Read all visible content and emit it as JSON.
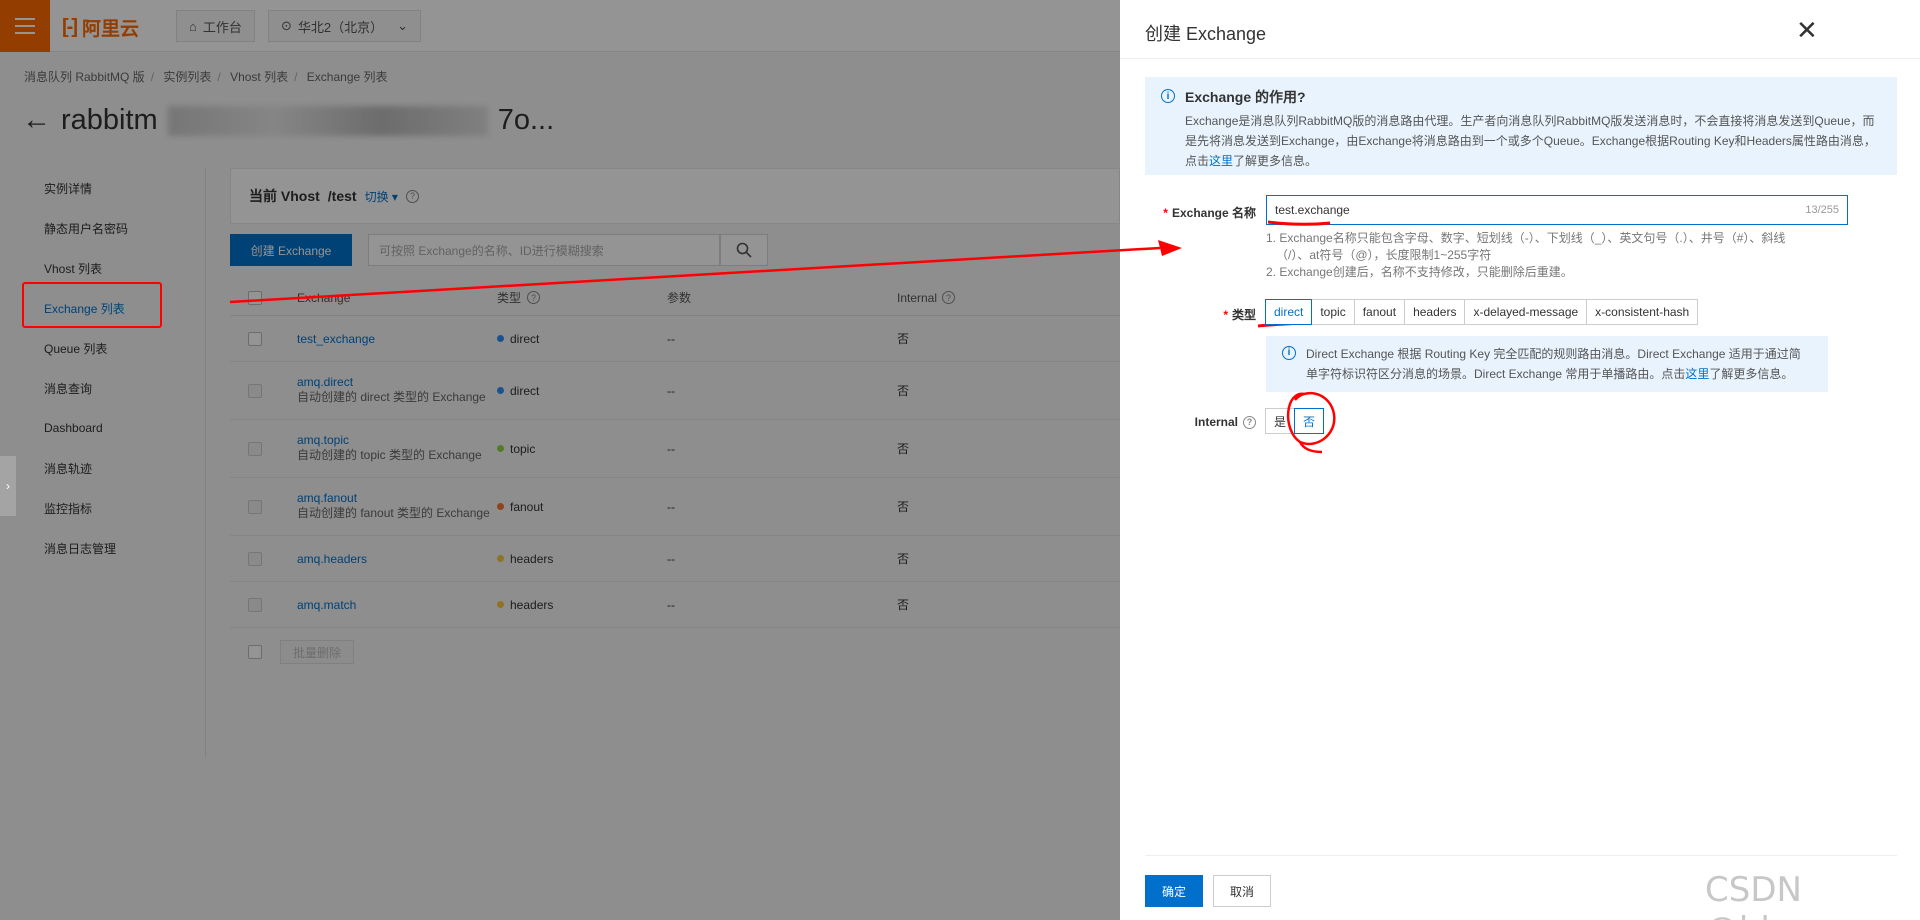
{
  "topbar": {
    "logo_text": "阿里云",
    "logo_mark": "[-]",
    "workbench_label": "工作台",
    "region_label": "华北2（北京）"
  },
  "breadcrumb": [
    "消息队列 RabbitMQ 版",
    "实例列表",
    "Vhost 列表",
    "Exchange 列表"
  ],
  "page_title": "rabbitmq-serverless-cn-20c3y7o...",
  "page_title_visible": "rabbitm",
  "page_title_tail": "7o...",
  "nav": {
    "items": [
      {
        "label": "实例详情"
      },
      {
        "label": "静态用户名密码"
      },
      {
        "label": "Vhost 列表"
      },
      {
        "label": "Exchange 列表"
      },
      {
        "label": "Queue 列表"
      },
      {
        "label": "消息查询"
      },
      {
        "label": "Dashboard"
      },
      {
        "label": "消息轨迹"
      },
      {
        "label": "监控指标"
      },
      {
        "label": "消息日志管理"
      }
    ]
  },
  "vhost": {
    "label": "当前 Vhost",
    "value": "/test",
    "switch_label": "切换"
  },
  "toolbar": {
    "create_label": "创建 Exchange",
    "search_placeholder": "可按照 Exchange的名称、ID进行模糊搜索"
  },
  "table": {
    "headers": {
      "name": "Exchange",
      "type": "类型",
      "args": "参数",
      "internal": "Internal"
    },
    "rows": [
      {
        "name": "test_exchange",
        "sub": "",
        "type": "direct",
        "type_color": "#2f8ef4",
        "args": "--",
        "internal": "否"
      },
      {
        "name": "amq.direct",
        "sub": "自动创建的 direct 类型的 Exchange",
        "type": "direct",
        "type_color": "#2f8ef4",
        "args": "--",
        "internal": "否"
      },
      {
        "name": "amq.topic",
        "sub": "自动创建的 topic 类型的 Exchange",
        "type": "topic",
        "type_color": "#8fd34a",
        "args": "--",
        "internal": "否"
      },
      {
        "name": "amq.fanout",
        "sub": "自动创建的 fanout 类型的 Exchange",
        "type": "fanout",
        "type_color": "#f4762f",
        "args": "--",
        "internal": "否"
      },
      {
        "name": "amq.headers",
        "sub": "",
        "type": "headers",
        "type_color": "#f4c542",
        "args": "--",
        "internal": "否"
      },
      {
        "name": "amq.match",
        "sub": "",
        "type": "headers",
        "type_color": "#f4c542",
        "args": "--",
        "internal": "否"
      }
    ],
    "batch_delete_label": "批量删除"
  },
  "drawer": {
    "title": "创建 Exchange",
    "info_title": "Exchange 的作用?",
    "info_text_1": "Exchange是消息队列RabbitMQ版的消息路由代理。生产者向消息队列RabbitMQ版发送消息时，不会直接将消息发送到Queue，而",
    "info_text_2": "是先将消息发送到Exchange，由Exchange将消息路由到一个或多个Queue。Exchange根据Routing Key和Headers属性路由消息，",
    "info_text_3a": "点击",
    "info_link": "这里",
    "info_text_3b": "了解更多信息。",
    "name_label": "Exchange 名称",
    "name_value": "test.exchange",
    "name_count": "13/255",
    "hint_1": "1. Exchange名称只能包含字母、数字、短划线（-）、下划线（_）、英文句号（.）、井号（#）、斜线",
    "hint_2": "（/）、at符号（@），长度限制1~255字符",
    "hint_3": "2. Exchange创建后，名称不支持修改，只能删除后重建。",
    "type_label": "类型",
    "type_options": [
      "direct",
      "topic",
      "fanout",
      "headers",
      "x-delayed-message",
      "x-consistent-hash"
    ],
    "type_desc_1": "Direct Exchange 根据 Routing Key 完全匹配的规则路由消息。Direct Exchange 适用于通过简",
    "type_desc_2a": "单字符标识符区分消息的场景。Direct Exchange 常用于单播路由。点击",
    "type_desc_link": "这里",
    "type_desc_2b": "了解更多信息。",
    "internal_label": "Internal",
    "internal_yes": "是",
    "internal_no": "否",
    "ok_label": "确定",
    "cancel_label": "取消"
  },
  "watermark": "CSDN @hhzz",
  "colors": {
    "brand": "#ff6a00",
    "primary": "#0070cc",
    "annotation": "#ff0000"
  }
}
